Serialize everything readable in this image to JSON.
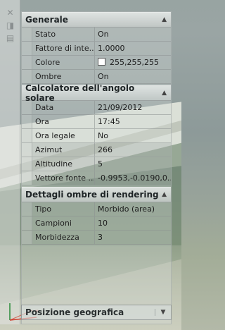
{
  "sections": [
    {
      "title": "Generale",
      "rows": [
        {
          "label": "Stato",
          "value": "On"
        },
        {
          "label": "Fattore di inte...",
          "value": "1.0000"
        },
        {
          "label": "Colore",
          "value": "255,255,255"
        },
        {
          "label": "Ombre",
          "value": "On"
        }
      ]
    },
    {
      "title": "Calcolatore dell'angolo solare",
      "rows": [
        {
          "label": "Data",
          "value": "21/09/2012"
        },
        {
          "label": "Ora",
          "value": "17:45"
        },
        {
          "label": "Ora legale",
          "value": "No"
        },
        {
          "label": "Azimut",
          "value": "266"
        },
        {
          "label": "Altitudine",
          "value": "5"
        },
        {
          "label": "Vettore fonte ...",
          "value": "-0.9953,-0.0190,0...."
        }
      ]
    },
    {
      "title": "Dettagli ombre di rendering",
      "rows": [
        {
          "label": "Tipo",
          "value": "Morbido (area)"
        },
        {
          "label": "Campioni",
          "value": "10"
        },
        {
          "label": "Morbidezza",
          "value": "3"
        }
      ]
    }
  ],
  "footer": {
    "dropdown_label": "Posizione geografica"
  },
  "colors": {
    "swatch": "#ffffff",
    "axis_x": "#d0392b",
    "axis_y": "#2a8a3a"
  },
  "icons": [
    "close-icon",
    "autohide-icon",
    "properties-icon",
    "collapse-caret-icon",
    "dropdown-arrow-icon"
  ]
}
